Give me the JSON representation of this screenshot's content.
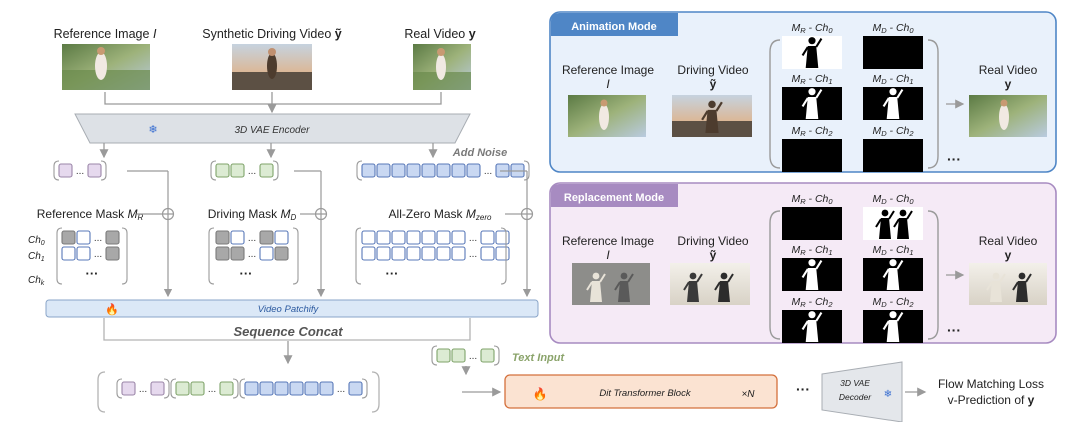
{
  "left": {
    "top_labels": {
      "reference_image": "Reference Image",
      "reference_image_sym": "I",
      "synthetic_video": "Synthetic Driving Video",
      "synthetic_video_sym": "ỹ",
      "real_video": "Real Video",
      "real_video_sym": "y"
    },
    "vae_encoder": "3D VAE Encoder",
    "add_noise": "Add Noise",
    "reference_mask": "Reference Mask",
    "reference_mask_sym": "M",
    "reference_mask_sub": "R",
    "driving_mask": "Driving Mask",
    "driving_mask_sym": "M",
    "driving_mask_sub": "D",
    "zero_mask": "All-Zero Mask",
    "zero_mask_sym": "M",
    "zero_mask_sub": "zero",
    "channels": [
      "Ch0",
      "Ch1",
      "Chk"
    ],
    "ellipsis_dots": "...",
    "dots": "···",
    "video_patchify": "Video Patchify",
    "sequence_concat": "Sequence Concat",
    "text_input": "Text Input",
    "dit_block": "Dit Transformer Block",
    "times_n": "×N",
    "vae_decoder_line1": "3D VAE",
    "vae_decoder_line2": "Decoder",
    "output_line1": "Flow Matching Loss",
    "output_line2": "v-Prediction of",
    "output_sym": "y"
  },
  "panels": [
    {
      "tag": "Animation Mode",
      "ref_label": "Reference Image",
      "ref_sym": "I",
      "drv_label": "Driving Video",
      "drv_sym": "ỹ",
      "out_label": "Real Video",
      "out_sym": "y",
      "masks": [
        "M_R - Ch_0",
        "M_D - Ch_0",
        "M_R - Ch_1",
        "M_D - Ch_1",
        "M_R - Ch_2",
        "M_D - Ch_2"
      ]
    },
    {
      "tag": "Replacement Mode",
      "ref_label": "Reference Image",
      "ref_sym": "I",
      "drv_label": "Driving Video",
      "drv_sym": "ỹ",
      "out_label": "Real Video",
      "out_sym": "y",
      "masks": [
        "M_R - Ch_0",
        "M_D - Ch_0",
        "M_R - Ch_1",
        "M_D - Ch_1",
        "M_R - Ch_2",
        "M_D - Ch_2"
      ]
    }
  ],
  "colors": {
    "purple": "#e6d9ee",
    "purple_border": "#9b86a8",
    "green": "#dcebd3",
    "green_border": "#7fa36a",
    "blue": "#c9d8f2",
    "blue_border": "#5878b8",
    "gray_cell": "#a8a8a8",
    "patchify_fill": "#dbe8f7",
    "dit_fill": "#fbe3d2",
    "dit_border": "#d4703c",
    "anim_panel_fill": "#e9f1fb",
    "anim_panel_border": "#4f86c6",
    "repl_panel_fill": "#f5eaf6",
    "repl_panel_border": "#a78bc1"
  }
}
